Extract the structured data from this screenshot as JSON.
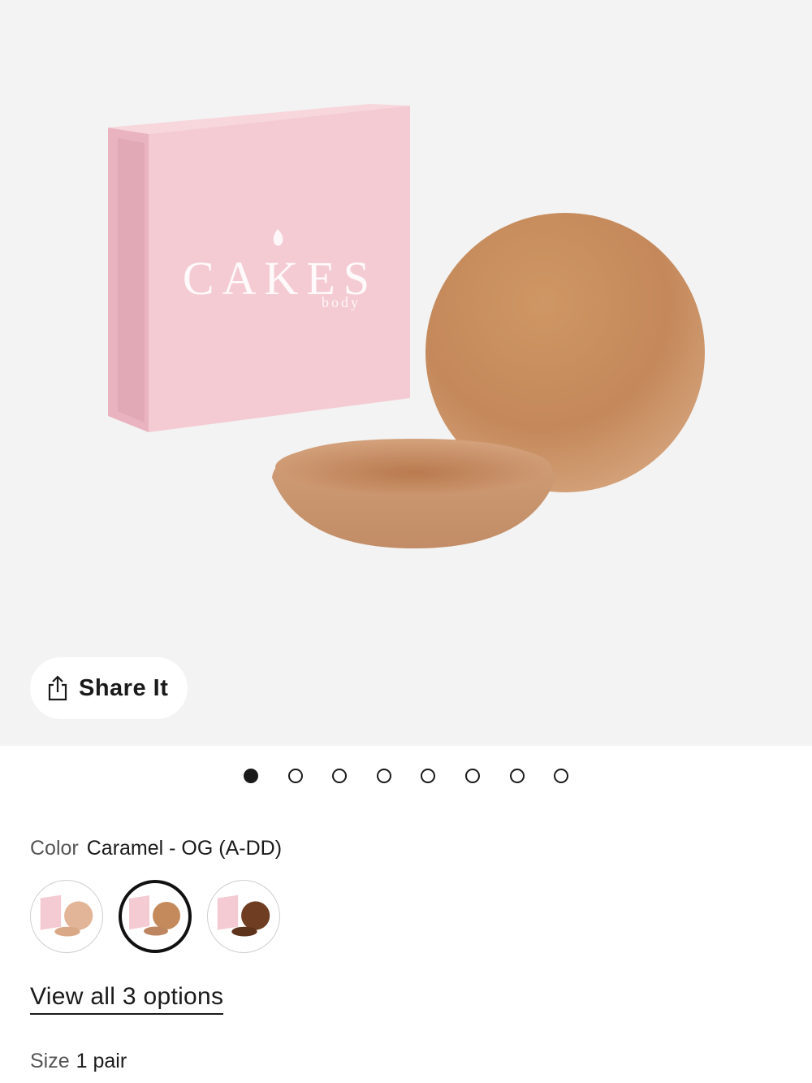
{
  "product_image": {
    "brand_logo": "CAKES",
    "brand_sub": "body",
    "colors": {
      "box": "#f3c9d0",
      "silicone": "#c98f5d"
    }
  },
  "share": {
    "label": "Share It",
    "icon": "share-icon"
  },
  "carousel": {
    "count": 8,
    "active_index": 0
  },
  "color": {
    "label": "Color",
    "selected_value": "Caramel - OG (A-DD)",
    "swatches": [
      {
        "shade": "#e2b598",
        "selected": false
      },
      {
        "shade": "#c48a5b",
        "selected": true
      },
      {
        "shade": "#6e3d22",
        "selected": false
      }
    ]
  },
  "view_all": {
    "label": "View all 3 options"
  },
  "size": {
    "label": "Size",
    "value": "1 pair"
  }
}
